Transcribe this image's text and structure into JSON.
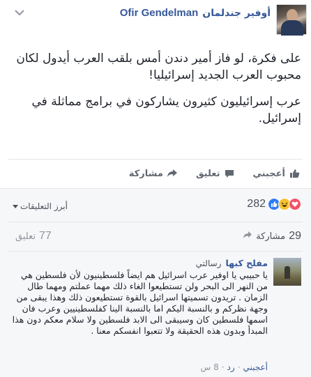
{
  "post": {
    "author_arabic": "أوفير جندلمان",
    "author_latin": "Ofir Gendelman",
    "paragraphs": [
      "على فكرة، لو فاز أمير دندن أمس بلقب العرب أيدول لكان محبوب العرب الجديد إسرائيليا!",
      "عرب إسرائيليون كثيرون يشاركون في برامج مماثلة في إسرائيل."
    ]
  },
  "actions": {
    "like": "أعجبني",
    "comment": "تعليق",
    "share": "مشاركة"
  },
  "feedback": {
    "top_comments": "أبرز التعليقات",
    "reaction_count": "282",
    "reactions": [
      "like-icon",
      "haha-icon",
      "love-icon"
    ],
    "shares_count": "29",
    "shares_label": "مشاركة",
    "comments_count": "77",
    "comments_label": "تعليق"
  },
  "comment": {
    "name": "مفلح كبها",
    "tag": "رسالتي",
    "text": "يا حبيبي يا اوفير عرب اسرائيل هم ايضاً فلسطينيون لأن فلسطين هي من النهر الى البحر ولن تستطيعوا الغاء ذلك مهما عملتم ومهما طال الزمان . تريدون تسميتها اسرائيل بالقوة تستطيعون ذلك وهذا يبقى من وجهة نظركم و بالنسبة اليكم اما بالنسبة الينا كفلسطينيين وعرب فان اسمها فلسطين كان وسيبقى الى الابد فلسطين ولا سلام معكم دون هذا المبدأ وبدون هذه الحقيقة ولا تتعبوا انفسكم معنا .",
    "like": "أعجبني",
    "reply": "رد",
    "dot": "·",
    "time": "8 س"
  },
  "colors": {
    "link": "#365899",
    "muted": "#90949c",
    "like_blue": "#2e7cf6",
    "love_red": "#f25268",
    "haha_yellow": "#f7c12f"
  }
}
